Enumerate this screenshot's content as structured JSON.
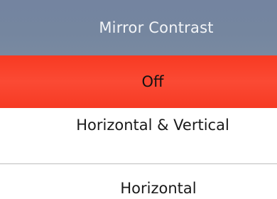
{
  "header": {
    "title": "Mirror Contrast"
  },
  "options": [
    {
      "label": "Off",
      "selected": true
    },
    {
      "label": "Horizontal & Vertical",
      "selected": false
    },
    {
      "label": "Horizontal",
      "selected": false
    }
  ],
  "colors": {
    "header_bg": "#75869f",
    "selected_bg": "#f83a22",
    "divider": "#bdbdbd"
  }
}
